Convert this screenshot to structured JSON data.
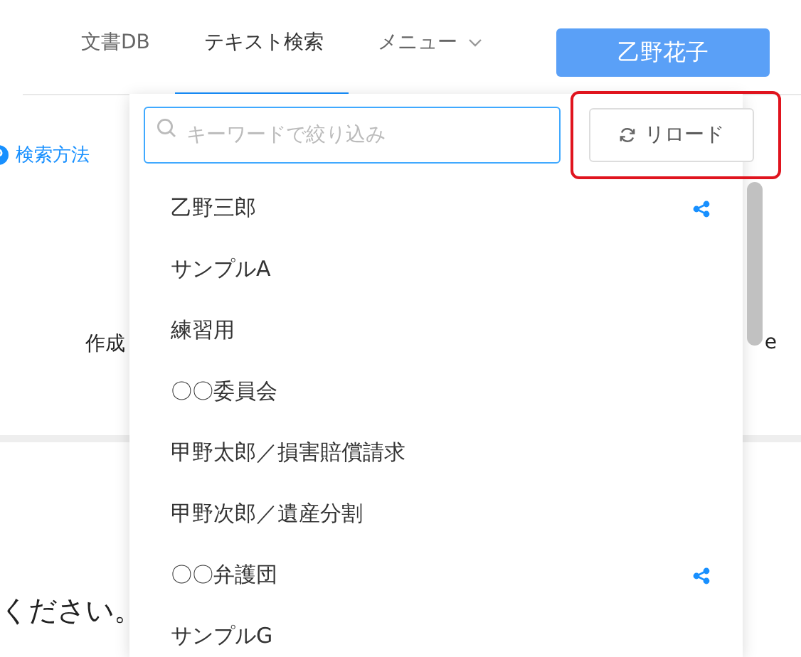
{
  "nav": {
    "tabs": [
      {
        "label": "文書DB",
        "selected": false,
        "kind": "link"
      },
      {
        "label": "テキスト検索",
        "selected": true,
        "kind": "link"
      },
      {
        "label": "メニュー",
        "selected": false,
        "kind": "dropdown"
      }
    ],
    "user_button": "乙野花子"
  },
  "help_link": "検索方法",
  "body_texts": {
    "left_label": "作成",
    "right_fragment": "e",
    "message": "ください。"
  },
  "dropdown": {
    "search": {
      "placeholder": "キーワードで絞り込み"
    },
    "reload_button": {
      "label": "リロード",
      "highlighted": true
    },
    "items": [
      {
        "label": "乙野三郎",
        "shared": true
      },
      {
        "label": "サンプルA",
        "shared": false
      },
      {
        "label": "練習用",
        "shared": false
      },
      {
        "label": "〇〇委員会",
        "shared": false
      },
      {
        "label": "甲野太郎／損害賠償請求",
        "shared": false
      },
      {
        "label": "甲野次郎／遺産分割",
        "shared": false
      },
      {
        "label": "〇〇弁護団",
        "shared": true
      },
      {
        "label": "サンプルG",
        "shared": false
      }
    ]
  }
}
